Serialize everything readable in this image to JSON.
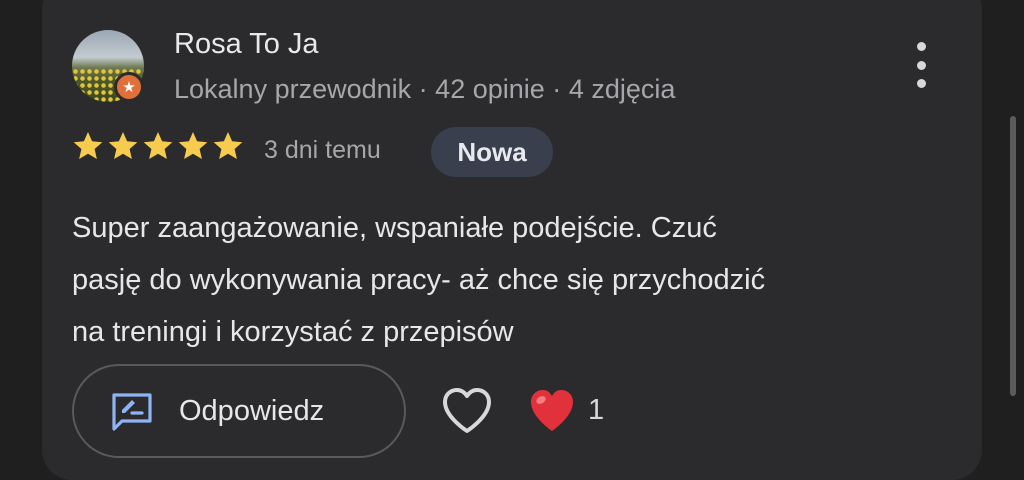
{
  "reviewer": {
    "name": "Rosa To Ja",
    "role": "Lokalny przewodnik",
    "separator": "·",
    "reviews_count": "42 opinie",
    "photos_count": "4 zdjęcia",
    "badge_icon": "star-icon",
    "badge_color": "#e0703a"
  },
  "review": {
    "rating": 5,
    "max_rating": 5,
    "star_color": "#f7cb4d",
    "date": "3 dni temu",
    "new_badge": "Nowa",
    "text_lines": [
      "Super zaangażowanie, wspaniałe podejście. Czuć",
      "pasję do wykonywania pracy- aż chce się przychodzić",
      "na treningi i korzystać z przepisów"
    ]
  },
  "actions": {
    "reply_label": "Odpowiedz",
    "reply_icon": "rate-review-icon",
    "like_icon": "heart-outline-icon",
    "reaction_icon": "red-heart-icon",
    "reaction_count": "1"
  },
  "menu": {
    "icon": "more-vertical-icon"
  }
}
